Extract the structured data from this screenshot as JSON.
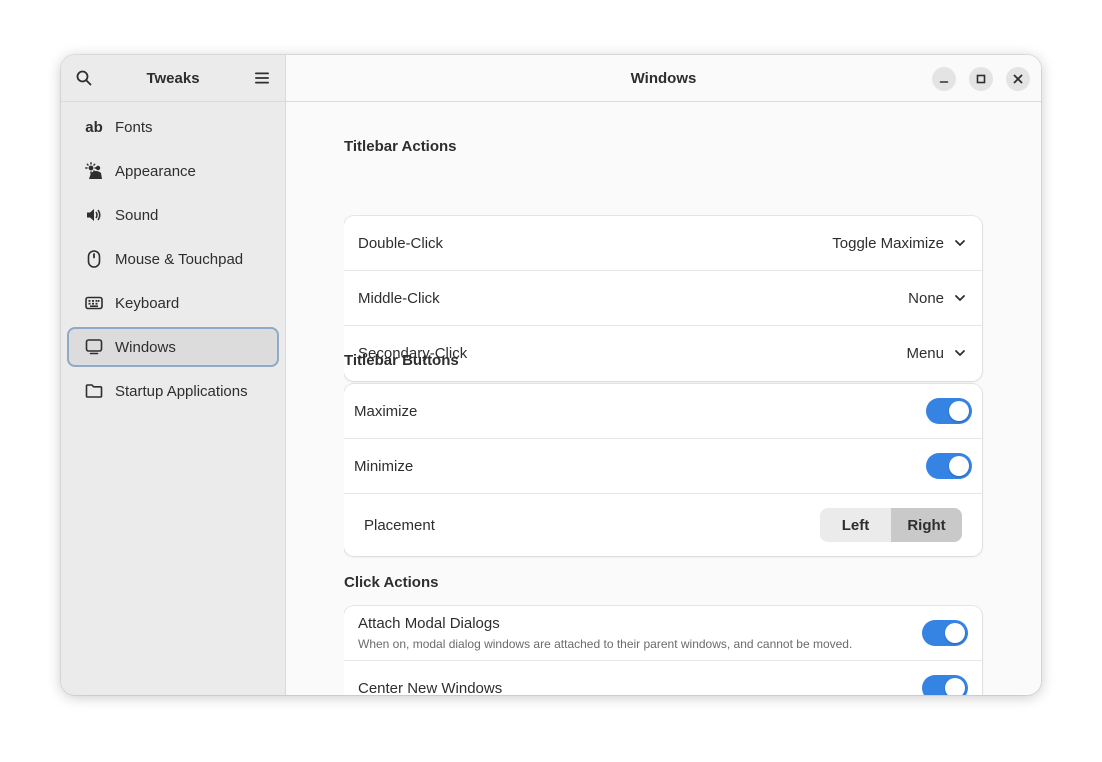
{
  "sidebar": {
    "title": "Tweaks",
    "search_icon": "search-icon",
    "menu_icon": "hamburger-menu-icon",
    "items": [
      {
        "label": "Fonts",
        "icon": "fonts-icon"
      },
      {
        "label": "Appearance",
        "icon": "appearance-icon"
      },
      {
        "label": "Sound",
        "icon": "speaker-icon"
      },
      {
        "label": "Mouse & Touchpad",
        "icon": "mouse-icon"
      },
      {
        "label": "Keyboard",
        "icon": "keyboard-icon"
      },
      {
        "label": "Windows",
        "icon": "monitor-icon",
        "active": true
      },
      {
        "label": "Startup Applications",
        "icon": "folder-icon"
      }
    ],
    "fonts_glyph": "ab"
  },
  "main": {
    "title": "Windows",
    "window_controls": [
      "minimize-icon",
      "maximize-icon",
      "close-icon"
    ],
    "titlebar_actions": {
      "heading": "Titlebar Actions",
      "rows": [
        {
          "label": "Double-Click",
          "value": "Toggle Maximize"
        },
        {
          "label": "Middle-Click",
          "value": "None"
        },
        {
          "label": "Secondary-Click",
          "value": "Menu"
        }
      ]
    },
    "titlebar_buttons": {
      "heading": "Titlebar Buttons",
      "maximize": {
        "label": "Maximize",
        "on": true
      },
      "minimize": {
        "label": "Minimize",
        "on": true
      },
      "placement": {
        "label": "Placement",
        "options": [
          "Left",
          "Right"
        ],
        "selected": "Right"
      }
    },
    "click_actions": {
      "heading": "Click Actions",
      "attach": {
        "label": "Attach Modal Dialogs",
        "subtitle": "When on, modal dialog windows are attached to their parent windows, and cannot be moved.",
        "on": true
      },
      "center": {
        "label": "Center New Windows",
        "on": true
      }
    }
  },
  "colors": {
    "accent": "#3584e4",
    "selected_outline": "#8fa9c8"
  }
}
